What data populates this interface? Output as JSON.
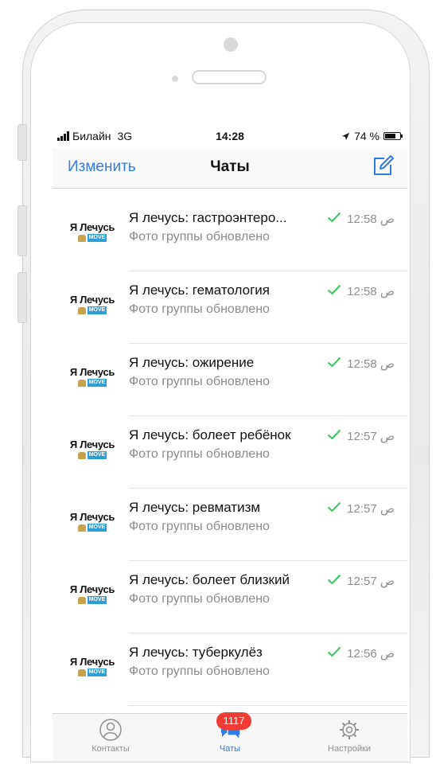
{
  "status_bar": {
    "carrier": "Билайн",
    "network": "3G",
    "time": "14:28",
    "battery": "74 %"
  },
  "nav": {
    "edit_label": "Изменить",
    "title": "Чаты"
  },
  "chats": [
    {
      "name": "Я лечусь: гастроэнтеро...",
      "preview": "Фото группы обновлено",
      "time": "12:58 ص",
      "avatar_text": "Я Лечусь",
      "avatar_badge": "MOVE"
    },
    {
      "name": "Я лечусь: гематология",
      "preview": "Фото группы обновлено",
      "time": "12:58 ص",
      "avatar_text": "Я Лечусь",
      "avatar_badge": "MOVE"
    },
    {
      "name": "Я лечусь: ожирение",
      "preview": "Фото группы обновлено",
      "time": "12:58 ص",
      "avatar_text": "Я Лечусь",
      "avatar_badge": "MOVE"
    },
    {
      "name": "Я лечусь: болеет ребёнок",
      "preview": "Фото группы обновлено",
      "time": "12:57 ص",
      "avatar_text": "Я Лечусь",
      "avatar_badge": "MOVE"
    },
    {
      "name": "Я лечусь: ревматизм",
      "preview": "Фото группы обновлено",
      "time": "12:57 ص",
      "avatar_text": "Я Лечусь",
      "avatar_badge": "MOVE"
    },
    {
      "name": "Я лечусь: болеет близкий",
      "preview": "Фото группы обновлено",
      "time": "12:57 ص",
      "avatar_text": "Я Лечусь",
      "avatar_badge": "MOVE"
    },
    {
      "name": "Я лечусь: туберкулёз",
      "preview": "Фото группы обновлено",
      "time": "12:56 ص",
      "avatar_text": "Я Лечусь",
      "avatar_badge": "MOVE"
    }
  ],
  "tabbar": {
    "contacts_label": "Контакты",
    "chats_label": "Чаты",
    "settings_label": "Настройки",
    "chats_badge": "1117"
  },
  "colors": {
    "accent": "#2e7de9",
    "check": "#35c759",
    "badge": "#f23b34"
  }
}
